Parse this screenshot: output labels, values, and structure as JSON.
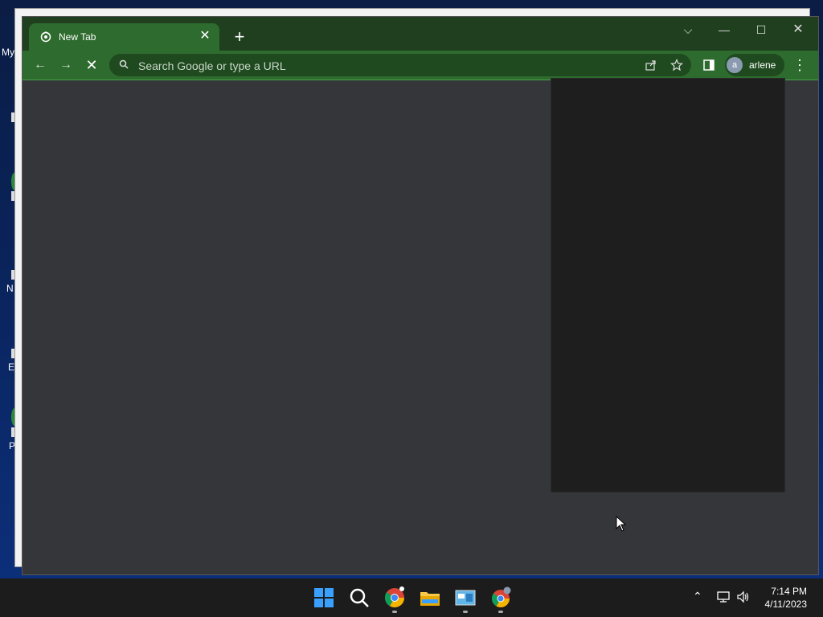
{
  "desktop": {
    "icon_labels": [
      "My",
      "N",
      "E",
      "P"
    ]
  },
  "browser": {
    "tab": {
      "title": "New Tab"
    },
    "omnibox": {
      "placeholder": "Search Google or type a URL"
    },
    "profile": {
      "initial": "a",
      "name": "arlene"
    }
  },
  "taskbar": {
    "apps": [
      "windows-start",
      "search",
      "chrome-dev",
      "file-explorer",
      "control-panel",
      "chrome-profile"
    ],
    "time": "7:14 PM",
    "date": "4/11/2023"
  },
  "colors": {
    "tabstrip": "#1f3f1f",
    "toolbar": "#2e6b2e",
    "content": "#35363a",
    "popup": "#1e1e1e",
    "taskbar": "#1c1c1c"
  }
}
